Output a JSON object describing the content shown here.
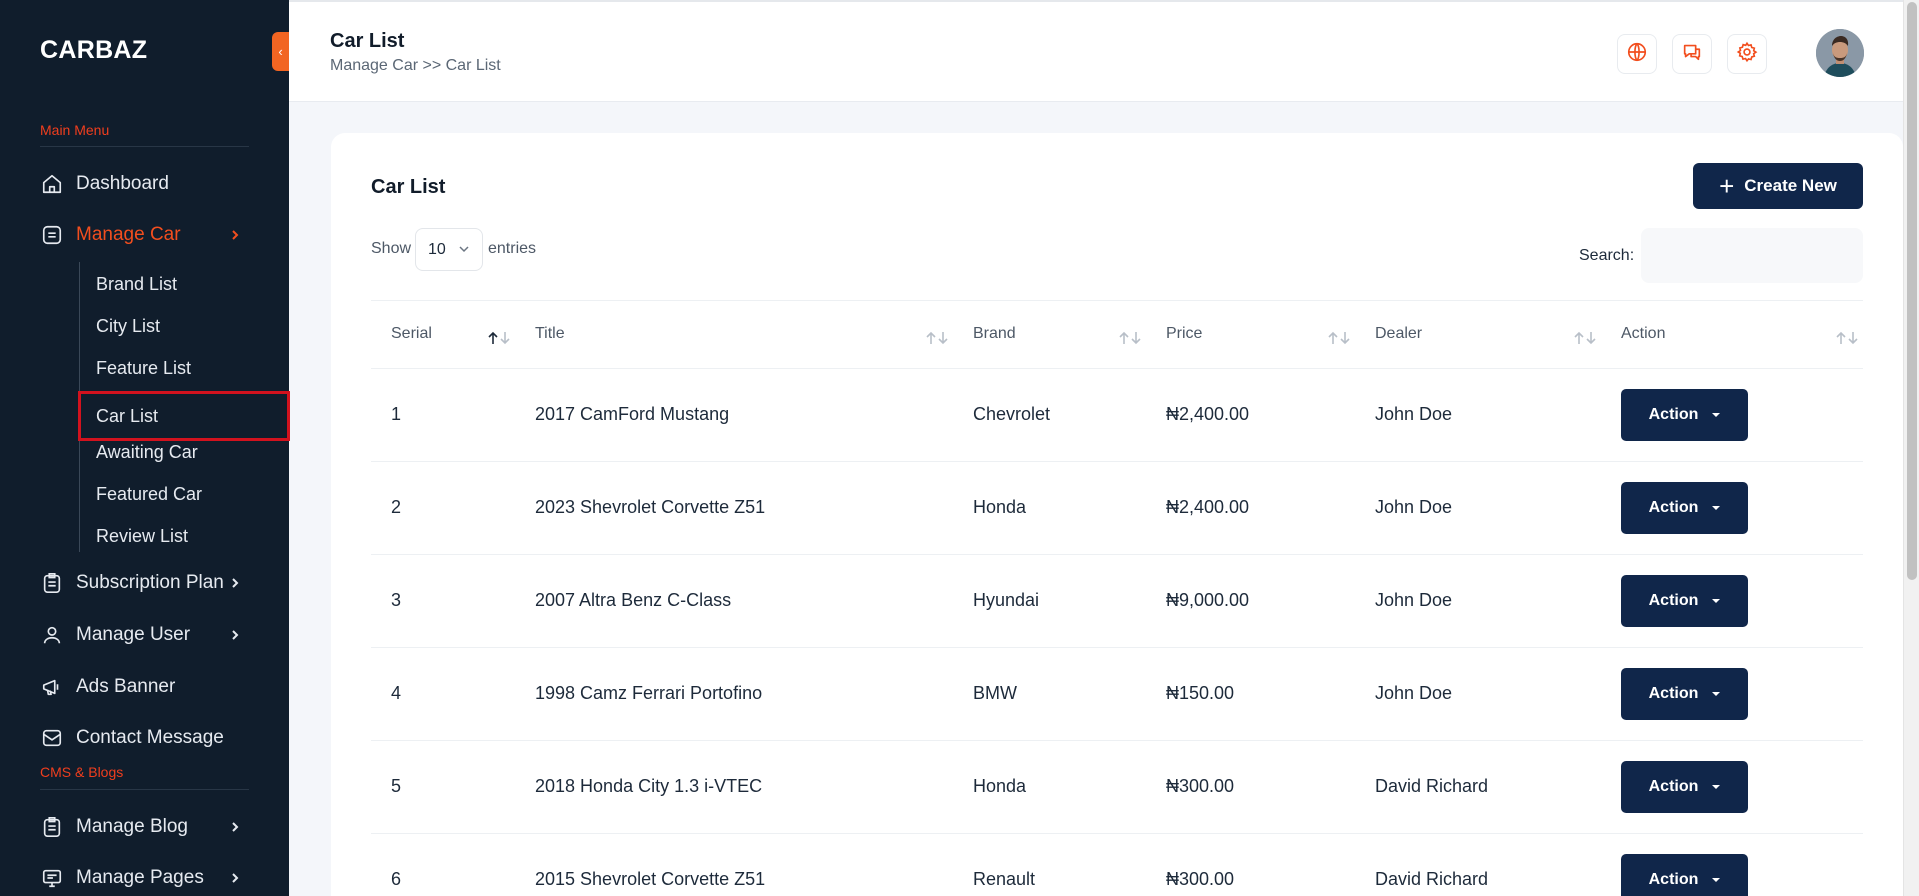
{
  "sidebar": {
    "brand": "CARBAZ",
    "sections": {
      "main": "Main Menu",
      "cms": "CMS & Blogs"
    },
    "items": {
      "dashboard": "Dashboard",
      "manage_car": "Manage Car",
      "subscription": "Subscription Plan",
      "manage_user": "Manage User",
      "ads_banner": "Ads Banner",
      "contact": "Contact Message",
      "manage_blog": "Manage Blog",
      "manage_pages": "Manage Pages"
    },
    "sub_items": [
      "Brand List",
      "City List",
      "Feature List",
      "Car List",
      "Awaiting Car",
      "Featured Car",
      "Review List"
    ],
    "active_color": "#f24e1e"
  },
  "header": {
    "title": "Car List",
    "breadcrumb": "Manage Car >> Car List",
    "icons": [
      "globe-icon",
      "chat-icon",
      "gear-icon"
    ]
  },
  "card": {
    "title": "Car List",
    "create_label": "Create New",
    "show_label": "Show",
    "entries_value": "10",
    "entries_label": "entries",
    "search_label": "Search:",
    "search_value": ""
  },
  "table": {
    "columns": [
      "Serial",
      "Title",
      "Brand",
      "Price",
      "Dealer",
      "Action"
    ],
    "rows": [
      {
        "serial": "1",
        "title": "2017 CamFord Mustang",
        "brand": "Chevrolet",
        "price": "₦2,400.00",
        "dealer": "John Doe",
        "action": "Action"
      },
      {
        "serial": "2",
        "title": "2023 Shevrolet Corvette Z51",
        "brand": "Honda",
        "price": "₦2,400.00",
        "dealer": "John Doe",
        "action": "Action"
      },
      {
        "serial": "3",
        "title": "2007 Altra Benz C-Class",
        "brand": "Hyundai",
        "price": "₦9,000.00",
        "dealer": "John Doe",
        "action": "Action"
      },
      {
        "serial": "4",
        "title": "1998 Camz Ferrari Portofino",
        "brand": "BMW",
        "price": "₦150.00",
        "dealer": "John Doe",
        "action": "Action"
      },
      {
        "serial": "5",
        "title": "2018 Honda City 1.3 i-VTEC",
        "brand": "Honda",
        "price": "₦300.00",
        "dealer": "David Richard",
        "action": "Action"
      },
      {
        "serial": "6",
        "title": "2015 Shevrolet Corvette Z51",
        "brand": "Renault",
        "price": "₦300.00",
        "dealer": "David Richard",
        "action": "Action"
      }
    ]
  },
  "colors": {
    "sidebar_bg": "#101d2c",
    "accent": "#f24e1e",
    "primary_button": "#10264a"
  }
}
